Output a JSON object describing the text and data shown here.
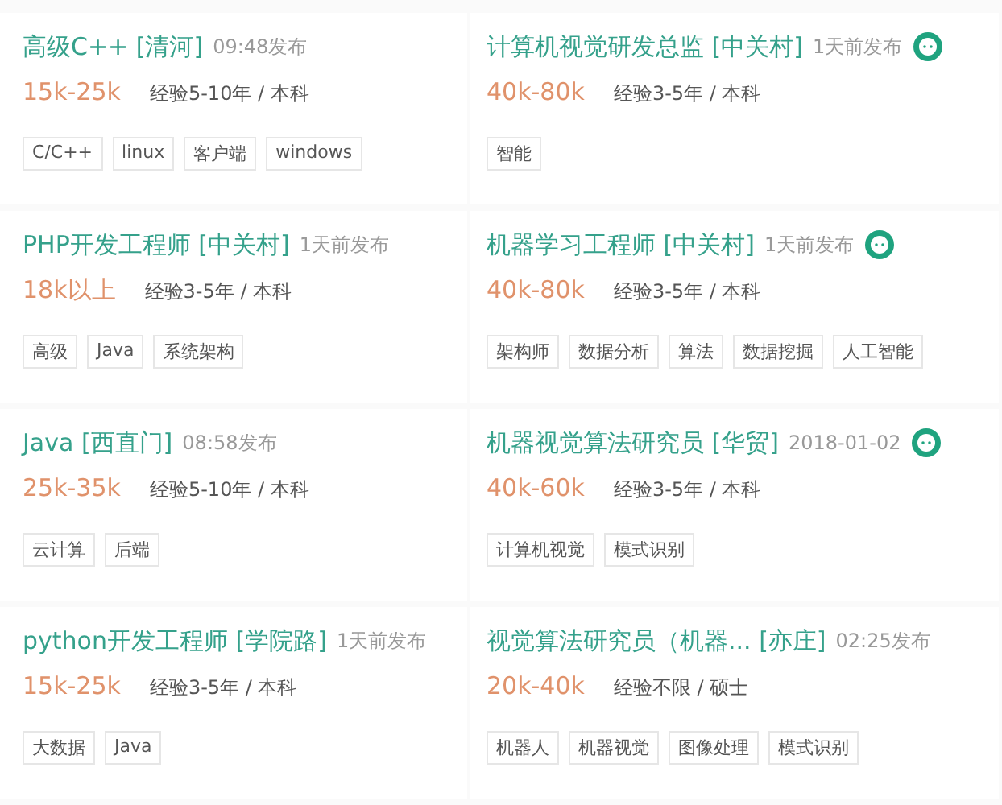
{
  "jobs": [
    {
      "title": "高级C++",
      "location": "[清河]",
      "time": "09:48发布",
      "chat": false,
      "salary": "15k-25k",
      "requirements": "经验5-10年 / 本科",
      "tags": [
        "C/C++",
        "linux",
        "客户端",
        "windows"
      ]
    },
    {
      "title": "计算机视觉研发总监",
      "location": "[中关村]",
      "time": "1天前发布",
      "chat": true,
      "salary": "40k-80k",
      "requirements": "经验3-5年 / 本科",
      "tags": [
        "智能"
      ]
    },
    {
      "title": "PHP开发工程师",
      "location": "[中关村]",
      "time": "1天前发布",
      "chat": false,
      "salary": "18k以上",
      "requirements": "经验3-5年 / 本科",
      "tags": [
        "高级",
        "Java",
        "系统架构"
      ]
    },
    {
      "title": "机器学习工程师",
      "location": "[中关村]",
      "time": "1天前发布",
      "chat": true,
      "salary": "40k-80k",
      "requirements": "经验3-5年 / 本科",
      "tags": [
        "架构师",
        "数据分析",
        "算法",
        "数据挖掘",
        "人工智能"
      ]
    },
    {
      "title": "Java",
      "location": "[西直门]",
      "time": "08:58发布",
      "chat": false,
      "salary": "25k-35k",
      "requirements": "经验5-10年 / 本科",
      "tags": [
        "云计算",
        "后端"
      ]
    },
    {
      "title": "机器视觉算法研究员",
      "location": "[华贸]",
      "time": "2018-01-02",
      "chat": true,
      "salary": "40k-60k",
      "requirements": "经验3-5年 / 本科",
      "tags": [
        "计算机视觉",
        "模式识别"
      ]
    },
    {
      "title": "python开发工程师",
      "location": "[学院路]",
      "time": "1天前发布",
      "chat": false,
      "salary": "15k-25k",
      "requirements": "经验3-5年 / 本科",
      "tags": [
        "大数据",
        "Java"
      ]
    },
    {
      "title": "视觉算法研究员（机器...",
      "location": "[亦庄]",
      "time": "02:25发布",
      "chat": false,
      "salary": "20k-40k",
      "requirements": "经验不限 / 硕士",
      "tags": [
        "机器人",
        "机器视觉",
        "图像处理",
        "模式识别"
      ]
    }
  ]
}
